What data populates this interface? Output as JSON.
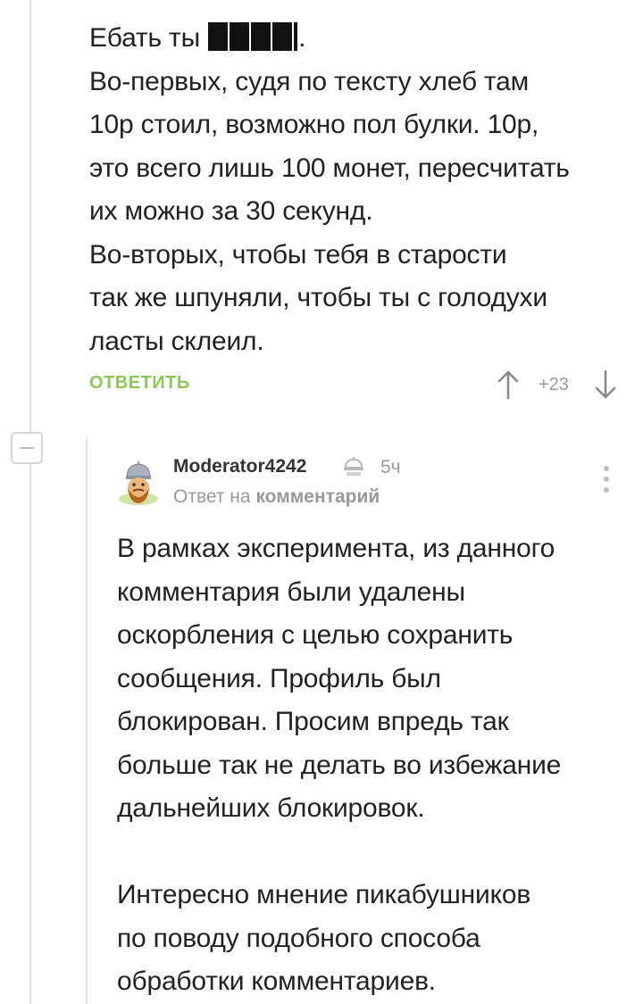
{
  "parent_comment": {
    "lines": [
      "Ебать ты",
      "Во-первых, судя по тексту хлеб там",
      "10р стоил, возможно пол булки. 10р,",
      "это всего лишь 100 монет, пересчитать",
      "их можно за 30 секунд.",
      "Во-вторых, чтобы тебя в старости",
      "так же шпуняли, чтобы ты с голодухи",
      "ласты склеил."
    ],
    "censor_suffix": ".",
    "reply_label": "ОТВЕТИТЬ",
    "rating": "+23"
  },
  "reply_comment": {
    "author": "Moderator4242",
    "time": "5ч",
    "reply_prefix": "Ответ на",
    "reply_link": "комментарий",
    "paragraph1": [
      "В рамках эксперимента, из данного",
      "комментария были удалены",
      "оскорбления с целью сохранить",
      "сообщения. Профиль был",
      "блокирован. Просим впредь так",
      "больше так не делать во избежание",
      "дальнейших блокировок."
    ],
    "paragraph2": [
      "Интересно мнение пикабушников",
      "по поводу подобного способа",
      "обработки комментариев."
    ]
  },
  "colors": {
    "reply_button": "#8ac858",
    "muted": "#999999",
    "thread_line": "#e2e2e2"
  },
  "icons": [
    "up-arrow-icon",
    "down-arrow-icon",
    "collapse-icon",
    "moderator-icon",
    "more-icon"
  ]
}
